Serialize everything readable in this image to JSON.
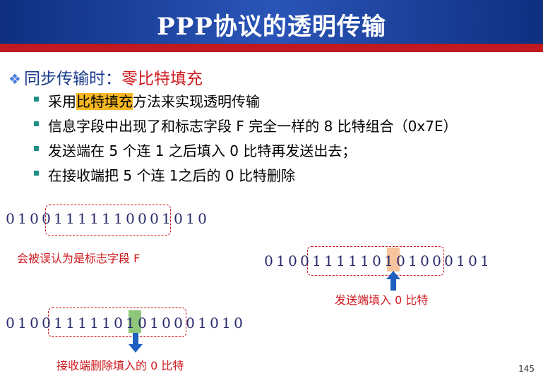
{
  "title": "PPP协议的透明传输",
  "heading": {
    "prefix": "同步传输时：",
    "highlight": "零比特填充"
  },
  "bullets": [
    {
      "before": "采用",
      "mark": "比特填充",
      "after": "方法来实现透明传输"
    },
    {
      "text": "信息字段中出现了和标志字段 F 完全一样的 8 比特组合（0x7E）"
    },
    {
      "text": "发送端在 5 个连 1 之后填入 0 比特再发送出去；"
    },
    {
      "text": "在接收端把 5 个连 1之后的 0 比特删除"
    }
  ],
  "row1": [
    "0",
    "1",
    "0",
    "0",
    "1",
    "1",
    "1",
    "1",
    "1",
    "1",
    "0",
    "0",
    "0",
    "1",
    "0",
    "1",
    "0"
  ],
  "row2": [
    "0",
    "1",
    "0",
    "0",
    "1",
    "1",
    "1",
    "1",
    "1",
    "0",
    "1",
    "0",
    "1",
    "0",
    "0",
    "0",
    "1",
    "0",
    "1"
  ],
  "row3": [
    "0",
    "1",
    "0",
    "0",
    "1",
    "1",
    "1",
    "1",
    "1",
    "0",
    "1",
    "0",
    "1",
    "0",
    "0",
    "0",
    "1",
    "0",
    "1",
    "0"
  ],
  "notes": {
    "flag": "会被误认为是标志字段 F",
    "send": "发送端填入 0 比特",
    "recv": "接收端删除填入的 0 比特"
  },
  "page_number": "145",
  "colors": {
    "title_bg": "#1a3a8c",
    "rule": "#c0191f",
    "accent_red": "#d0191f",
    "bit_blue": "#2b2b6e"
  }
}
